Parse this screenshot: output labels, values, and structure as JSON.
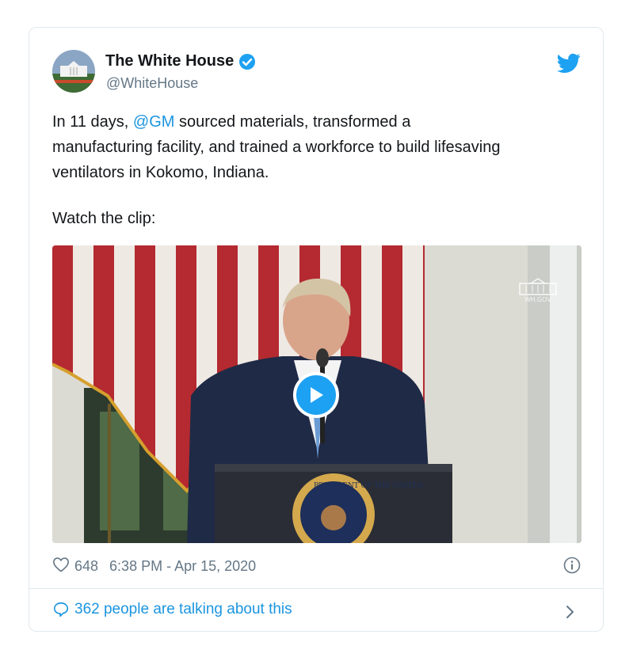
{
  "tweet": {
    "author_name": "The White House",
    "handle": "@WhiteHouse",
    "text_before_mention": "In 11 days, ",
    "mention": "@GM",
    "text_after_mention": " sourced materials, transformed a\nmanufacturing facility, and trained a workforce to build lifesaving\nventilators in Kokomo, Indiana.",
    "watch_text": "Watch the clip:",
    "likes": "648",
    "timestamp": "6:38 PM - Apr 15, 2020",
    "conversation": "362 people are talking about this",
    "watermark": "WH.GOV",
    "seal_text": "PRESIDENT OF THE UNITED"
  },
  "icons": {
    "verified": "verified-badge-icon",
    "bird": "twitter-bird-icon",
    "play": "play-icon",
    "heart": "heart-icon",
    "info": "info-icon",
    "comment": "comment-bubble-icon",
    "chevron": "chevron-right-icon"
  },
  "colors": {
    "accent": "#1da1f2",
    "link": "#1b95e0",
    "muted": "#657786",
    "border": "#e1e8ed"
  }
}
